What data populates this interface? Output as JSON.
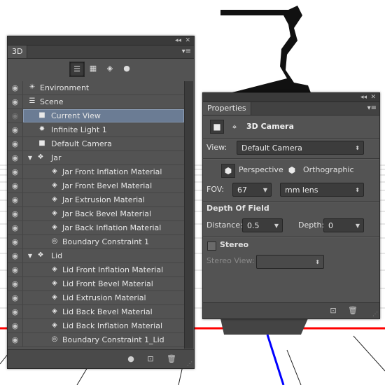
{
  "colors": {
    "panel_bg": "#535353",
    "selection": "#6b7c94",
    "axis_red": "#ff0000",
    "axis_blue": "#0000ff"
  },
  "panel3d": {
    "title_buttons": {
      "collapse": "◂◂",
      "close": "✕"
    },
    "tab_label": "3D",
    "menu_icon": "▾≡",
    "toolbar": [
      {
        "name": "scene-filter-icon",
        "glyph": "☰",
        "active": true
      },
      {
        "name": "mesh-filter-icon",
        "glyph": "▦",
        "active": false
      },
      {
        "name": "material-filter-icon",
        "glyph": "◈",
        "active": false
      },
      {
        "name": "light-filter-icon",
        "glyph": "●",
        "active": false
      }
    ],
    "rows": [
      {
        "label": "Environment",
        "icon": "environment-icon",
        "glyph": "☀",
        "level": 0,
        "twisty": "",
        "eye": true,
        "selected": false
      },
      {
        "label": "Scene",
        "icon": "scene-icon",
        "glyph": "☰",
        "level": 0,
        "twisty": "",
        "eye": true,
        "selected": false
      },
      {
        "label": "Current View",
        "icon": "camera-icon",
        "glyph": "■",
        "level": 1,
        "twisty": "",
        "eye": false,
        "selected": true
      },
      {
        "label": "Infinite Light 1",
        "icon": "light-icon",
        "glyph": "✹",
        "level": 1,
        "twisty": "",
        "eye": true,
        "selected": false
      },
      {
        "label": "Default Camera",
        "icon": "camera-icon",
        "glyph": "■",
        "level": 1,
        "twisty": "",
        "eye": true,
        "selected": false
      },
      {
        "label": "Jar",
        "icon": "mesh-icon",
        "glyph": "❖",
        "level": 0,
        "twisty": "▼",
        "eye": true,
        "selected": false
      },
      {
        "label": "Jar Front Inflation Material",
        "icon": "material-icon",
        "glyph": "◈",
        "level": 2,
        "twisty": "",
        "eye": true,
        "selected": false
      },
      {
        "label": "Jar Front Bevel Material",
        "icon": "material-icon",
        "glyph": "◈",
        "level": 2,
        "twisty": "",
        "eye": true,
        "selected": false
      },
      {
        "label": "Jar Extrusion Material",
        "icon": "material-icon",
        "glyph": "◈",
        "level": 2,
        "twisty": "",
        "eye": true,
        "selected": false
      },
      {
        "label": "Jar Back Bevel Material",
        "icon": "material-icon",
        "glyph": "◈",
        "level": 2,
        "twisty": "",
        "eye": true,
        "selected": false
      },
      {
        "label": "Jar Back Inflation Material",
        "icon": "material-icon",
        "glyph": "◈",
        "level": 2,
        "twisty": "",
        "eye": true,
        "selected": false
      },
      {
        "label": "Boundary Constraint 1",
        "icon": "constraint-icon",
        "glyph": "◎",
        "level": 2,
        "twisty": "",
        "eye": true,
        "selected": false
      },
      {
        "label": "Lid",
        "icon": "mesh-icon",
        "glyph": "❖",
        "level": 0,
        "twisty": "▼",
        "eye": true,
        "selected": false
      },
      {
        "label": "Lid Front Inflation Material",
        "icon": "material-icon",
        "glyph": "◈",
        "level": 2,
        "twisty": "",
        "eye": true,
        "selected": false
      },
      {
        "label": "Lid Front Bevel Material",
        "icon": "material-icon",
        "glyph": "◈",
        "level": 2,
        "twisty": "",
        "eye": true,
        "selected": false
      },
      {
        "label": "Lid Extrusion Material",
        "icon": "material-icon",
        "glyph": "◈",
        "level": 2,
        "twisty": "",
        "eye": true,
        "selected": false
      },
      {
        "label": "Lid Back Bevel Material",
        "icon": "material-icon",
        "glyph": "◈",
        "level": 2,
        "twisty": "",
        "eye": true,
        "selected": false
      },
      {
        "label": "Lid Back Inflation Material",
        "icon": "material-icon",
        "glyph": "◈",
        "level": 2,
        "twisty": "",
        "eye": true,
        "selected": false
      },
      {
        "label": "Boundary Constraint 1_Lid",
        "icon": "constraint-icon",
        "glyph": "◎",
        "level": 2,
        "twisty": "",
        "eye": true,
        "selected": false
      }
    ],
    "footer": {
      "light_glyph": "●",
      "add_glyph": "⊡",
      "delete_glyph": "🗑",
      "grip": "⋰"
    }
  },
  "properties": {
    "tab_label": "Properties",
    "menu_icon": "▾≡",
    "title_buttons": {
      "collapse": "◂◂",
      "close": "✕"
    },
    "header_title": "3D Camera",
    "view_label": "View:",
    "view_value": "Default Camera",
    "perspective_label": "Perspective",
    "orthographic_label": "Orthographic",
    "fov_label": "FOV:",
    "fov_value": "67",
    "lens_value": "mm lens",
    "dof_title": "Depth Of Field",
    "distance_label": "Distance:",
    "distance_value": "0.5",
    "depth_label": "Depth:",
    "depth_value": "0",
    "stereo_label": "Stereo",
    "stereo_view_label": "Stereo View:",
    "stereo_view_value": "",
    "footer": {
      "add_glyph": "⊡",
      "delete_glyph": "🗑",
      "grip": "⋰"
    }
  }
}
